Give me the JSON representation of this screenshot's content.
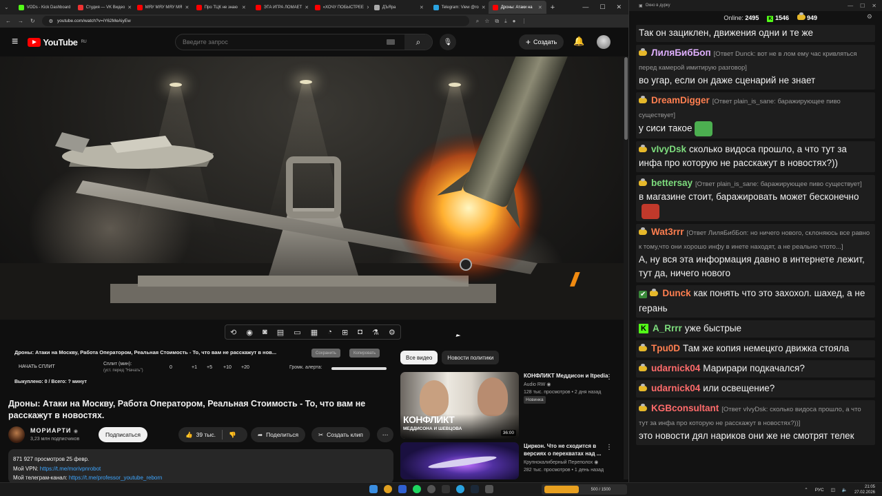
{
  "browser": {
    "tabs": [
      {
        "title": "VODs - Kick Dashboard",
        "color": "#53fc18"
      },
      {
        "title": "Студия — VK Видео",
        "color": "#e33"
      },
      {
        "title": "MЯУ MЯУ MЯУ МЯ",
        "color": "#f00"
      },
      {
        "title": "Про ТЦК не знаю",
        "color": "#f00"
      },
      {
        "title": "ЭТА ИГРА ЛОМАЕТ",
        "color": "#f00"
      },
      {
        "title": "«ХОЧУ ПОБЫСТРЕЕ",
        "color": "#f00"
      },
      {
        "title": "ДЪЯра",
        "color": "#aaa"
      },
      {
        "title": "Telegram: View @ro",
        "color": "#2aa3e0"
      },
      {
        "title": "Дроны: Атаки на",
        "color": "#f00",
        "active": true
      }
    ],
    "url": "youtube.com/watch?v=iY62MeAiyEw",
    "new_tab": "+",
    "window_controls": [
      "—",
      "☐",
      "✕"
    ]
  },
  "youtube": {
    "logo_text": "YouTube",
    "region": "RU",
    "search_placeholder": "Введите запрос",
    "create_label": "Создать",
    "video_title_short": "Дроны: Атаки на Москву, Работа Оператором, Реальная Стоимость - То, что вам не расскажут в нов...",
    "video_title": "Дроны: Атаки на Москву, Работа Оператором, Реальная Стоимость - То, что вам не расскажут в новостях.",
    "pill_save": "Сохранить",
    "pill_copy": "Копировать",
    "split": {
      "start_label": "НАЧАТЬ СПЛИТ",
      "minutes_label": "Сплит (мин):",
      "minutes_hint": "(уст. перед \"Начать\")",
      "value": "0",
      "increments": [
        "+1",
        "+5",
        "+10",
        "+20"
      ],
      "alert_label": "Громк. алерта:",
      "alert_volume": 1.0,
      "done_text": "Выкуплено: 0 / Всего: ? минут"
    },
    "channel": {
      "name": "МОРИАРТИ",
      "subs": "3,23 млн подписчиков",
      "subscribe_label": "Подписаться"
    },
    "actions": {
      "likes": "39 тыс.",
      "share": "Поделиться",
      "clip": "Создать клип",
      "more": "⋯"
    },
    "description": {
      "stats": "871 927 просмотров  25 февр.",
      "vpn_label": "Мой VPN: ",
      "vpn_link": "https://t.me/morivpnrobot",
      "tg_label": "Мой телеграм-канал: ",
      "tg_link": "https://t.me/professor_youtube_reborn"
    },
    "chips": [
      "Все видео",
      "Новости политики"
    ],
    "recommendations": [
      {
        "title": "КОНФЛИКТ Меддисон и Itpedia",
        "channel": "Audio RW",
        "meta": "128 тыс. просмотров • 2 дня назад",
        "badge": "Новинка",
        "duration": "36:00",
        "thumb_text_1": "КОНФЛИКТ",
        "thumb_text_2": "МЕДДИСОНА И ШЕВЦОВА"
      },
      {
        "title": "Циркон. Что не сходится в версиях о перехватах над ...",
        "channel": "Крупнокалиберный Переполох",
        "meta": "282 тыс. просмотров • 1 день назад"
      }
    ]
  },
  "chat": {
    "window_title": "Окно в дурку",
    "online_label": "Online:",
    "online": "2495",
    "kick_count": "1546",
    "other_count": "949",
    "messages": [
      {
        "user": "",
        "color": "#fff",
        "text": "Так он зациклен, движения одни и те же",
        "reply": ""
      },
      {
        "user": "ЛиляБибБоп",
        "color": "#e0b0ff",
        "reply": "[Ответ Dunck: вот не в лом ему час кривляться перед камерой имитирую разговор]",
        "text": "во угар, если он даже сценарий не знает"
      },
      {
        "user": "DreamDigger",
        "color": "#ff7f50",
        "reply": "[Ответ plain_is_sane: баражирующее пиво существует]",
        "text": "у сиси такое",
        "emote": "#4caf50"
      },
      {
        "user": "vIvyDsk",
        "color": "#7ddc7d",
        "reply": "",
        "text": "сколько видоса прошло, а что тут за инфа про которую не расскажут в новостях?))"
      },
      {
        "user": "bettersay",
        "color": "#7ddc7d",
        "reply": "[Ответ plain_is_sane: баражирующее пиво существует]",
        "text": "в магазине стоит, баражировать может бесконечно",
        "emote": "#c0392b"
      },
      {
        "user": "Wat3rrr",
        "color": "#ff7f50",
        "reply": "[Ответ ЛиляБибБоп: но ничего нового, склоняюсь все равно к тому,что они хорошо инфу в инете находят, а не реально чтото...]",
        "text": "А, ну вся эта информация давно в интернете лежит, тут да, ничего нового"
      },
      {
        "user": "Dunck",
        "color": "#ff7f50",
        "reply": "",
        "text": "как понять что это захохол. шахед, а не герань",
        "check": true
      },
      {
        "user": "A_Rrrr",
        "color": "#7ddc7d",
        "reply": "",
        "text": "уже быстрые",
        "kick": true
      },
      {
        "user": "Tpu0D",
        "color": "#ff7f50",
        "reply": "",
        "text": "Там же копия немецкго движка стояла"
      },
      {
        "user": "udarnick04",
        "color": "#ff6b6b",
        "reply": "",
        "text": "Марирари  подкачался?"
      },
      {
        "user": "udarnick04",
        "color": "#ff6b6b",
        "reply": "",
        "text": "или освещение?"
      },
      {
        "user": "KGBconsultant",
        "color": "#ff6b6b",
        "reply": "[Ответ vIvyDsk: сколько видоса прошло, а что тут за инфа про которую не расскажут в новостях?))]",
        "text": "это новости дял нариков они же не смотрят телек"
      }
    ]
  },
  "taskbar": {
    "widget_text": "500 / 1500",
    "lang": "РУС",
    "time": "21:05",
    "date": "27.02.2026"
  }
}
